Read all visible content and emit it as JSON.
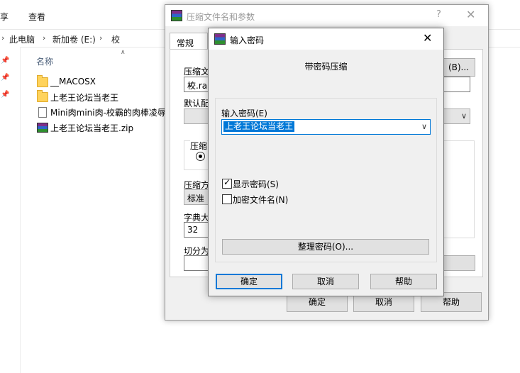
{
  "explorer": {
    "ribbon_tabs": [
      "享",
      "查看"
    ],
    "breadcrumb": [
      "此电脑",
      "新加卷 (E:)",
      "校"
    ],
    "column_header": "名称",
    "files": [
      {
        "name": "__MACOSX",
        "icon": "folder-icon"
      },
      {
        "name": "上老王论坛当老王",
        "icon": "folder-icon"
      },
      {
        "name": "Mini肉mini肉-校霸的肉棒凌辱",
        "icon": "document-icon"
      },
      {
        "name": "上老王论坛当老王.zip",
        "icon": "winrar-archive-icon"
      }
    ]
  },
  "archive_dialog": {
    "title": "压缩文件名和参数",
    "help_glyph": "?",
    "close_glyph": "✕",
    "tab_general": "常规",
    "archive_name_label": "压缩文",
    "archive_name_value": "校.rar",
    "browse_button": "(B)...",
    "default_profile_label": "默认配",
    "compression_group_label": "压缩",
    "method_label": "压缩方",
    "method_value": "标准",
    "dict_label": "字典大",
    "dict_value": "32",
    "split_label": "切分为",
    "ok": "确定",
    "cancel": "取消",
    "help": "帮助"
  },
  "password_dialog": {
    "title": "输入密码",
    "close_glyph": "✕",
    "subtitle": "带密码压缩",
    "password_label": "输入密码(E)",
    "password_value": "上老王论坛当老王",
    "show_password_label": "显示密码(S)",
    "show_password_checked": true,
    "encrypt_names_label": "加密文件名(N)",
    "encrypt_names_checked": false,
    "organize_button": "整理密码(O)...",
    "ok": "确定",
    "cancel": "取消",
    "help": "帮助",
    "accent_color": "#0078d7"
  }
}
